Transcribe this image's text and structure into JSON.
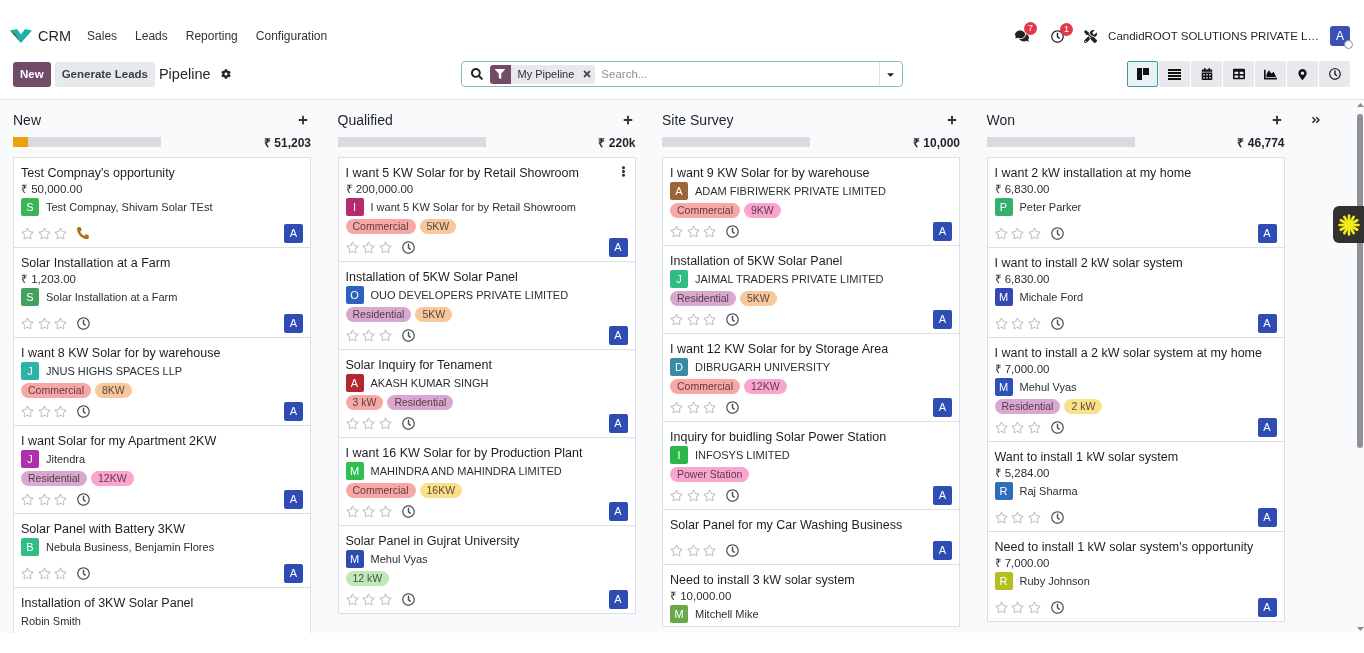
{
  "navbar": {
    "app": "CRM",
    "menu": [
      "Sales",
      "Leads",
      "Reporting",
      "Configuration"
    ],
    "messages_count": "7",
    "activities_count": "1",
    "company": "CandidROOT SOLUTIONS PRIVATE L…",
    "user_initial": "A"
  },
  "control_panel": {
    "buttons": [
      {
        "label": "New",
        "kind": "primary"
      },
      {
        "label": "Generate Leads",
        "kind": "secondary"
      }
    ],
    "title": "Pipeline",
    "search": {
      "facet": "My Pipeline",
      "placeholder": "Search..."
    },
    "views": [
      {
        "kind": "kanban",
        "selected": true
      },
      {
        "kind": "list",
        "selected": false
      },
      {
        "kind": "calendar",
        "selected": false
      },
      {
        "kind": "pivot",
        "selected": false
      },
      {
        "kind": "graph",
        "selected": false
      },
      {
        "kind": "map",
        "selected": false
      },
      {
        "kind": "activity",
        "selected": false
      }
    ]
  },
  "columns": [
    {
      "title": "New",
      "total": "₹ 51,203",
      "level": 0.1,
      "cards": [
        {
          "title": "Test Compnay's opportunity",
          "amount": "₹ 50,000.00",
          "partner": {
            "initial": "S",
            "name": "Test Compnay, Shivam Solar TEst",
            "color": "#3cb55a"
          },
          "stars": 0,
          "call_planned": true,
          "assignee": "A",
          "show_menu": false
        },
        {
          "title": "Solar Installation at a Farm",
          "amount": "₹ 1,203.00",
          "partner": {
            "initial": "S",
            "name": "Solar Installation at a Farm",
            "color": "#46a160"
          },
          "stars": 0,
          "call_planned": false,
          "assignee": "A",
          "show_menu": false
        },
        {
          "title": "I want 8 KW Solar for by warehouse",
          "partner": {
            "initial": "J",
            "name": "JNUS HIGHS SPACES LLP",
            "color": "#2bb5a8"
          },
          "tags": [
            {
              "label": "Commercial",
              "color": "#f7a8a6"
            },
            {
              "label": "8KW",
              "color": "#f6c89c"
            }
          ],
          "stars": 0,
          "call_planned": false,
          "assignee": "A",
          "show_menu": false
        },
        {
          "title": "I want Solar for my Apartment 2KW",
          "partner": {
            "initial": "J",
            "name": "Jitendra",
            "color": "#b12fab"
          },
          "tags": [
            {
              "label": "Residential",
              "color": "#d9a8d0"
            },
            {
              "label": "12KW",
              "color": "#f9a5cf"
            }
          ],
          "stars": 0,
          "call_planned": false,
          "assignee": "A",
          "show_menu": false
        },
        {
          "title": "Solar Panel with Battery 3KW",
          "partner": {
            "initial": "B",
            "name": "Nebula Business, Benjamin Flores",
            "color": "#2fbf85"
          },
          "stars": 0,
          "call_planned": false,
          "assignee": "A",
          "show_menu": false
        },
        {
          "title": "Installation of 3KW Solar Panel",
          "partner": {
            "name": "Robin Smith"
          },
          "show_menu": false
        }
      ]
    },
    {
      "title": "Qualified",
      "total": "₹ 220k",
      "cards": [
        {
          "title": "I want 5 KW Solar for by Retail Showroom",
          "amount": "₹ 200,000.00",
          "partner": {
            "initial": "I",
            "name": "I want 5 KW Solar for by Retail Showroom",
            "color": "#b62a6f"
          },
          "tags": [
            {
              "label": "Commercial",
              "color": "#f7a8a6"
            },
            {
              "label": "5KW",
              "color": "#f6c89c"
            }
          ],
          "stars": 0,
          "call_planned": false,
          "assignee": "A",
          "show_menu": true
        },
        {
          "title": "Installation of 5KW Solar Panel",
          "partner": {
            "initial": "O",
            "name": "OUO DEVELOPERS PRIVATE LIMITED",
            "color": "#2d62c0"
          },
          "tags": [
            {
              "label": "Residential",
              "color": "#d9a8d0"
            },
            {
              "label": "5KW",
              "color": "#f6c89c"
            }
          ],
          "stars": 0,
          "call_planned": false,
          "assignee": "A",
          "show_menu": false
        },
        {
          "title": "Solar Inquiry for Tenament",
          "partner": {
            "initial": "A",
            "name": "AKASH KUMAR SINGH",
            "color": "#b3282f"
          },
          "tags": [
            {
              "label": "3 kW",
              "color": "#f7a8a6"
            },
            {
              "label": "Residential",
              "color": "#d9a8d0"
            }
          ],
          "stars": 0,
          "call_planned": false,
          "assignee": "A",
          "show_menu": false
        },
        {
          "title": "I want 16 KW Solar for by Production Plant",
          "partner": {
            "initial": "M",
            "name": "MAHINDRA AND MAHINDRA LIMITED",
            "color": "#2ec04f"
          },
          "tags": [
            {
              "label": "Commercial",
              "color": "#f7a8a6"
            },
            {
              "label": "16KW",
              "color": "#fbe08a"
            }
          ],
          "stars": 0,
          "call_planned": false,
          "assignee": "A",
          "show_menu": false
        },
        {
          "title": "Solar Panel in Gujrat University",
          "partner": {
            "initial": "M",
            "name": "Mehul Vyas",
            "color": "#2b4cb3"
          },
          "tags": [
            {
              "label": "12 kW",
              "color": "#bdeab8"
            }
          ],
          "stars": 0,
          "call_planned": false,
          "assignee": "A",
          "show_menu": false
        }
      ]
    },
    {
      "title": "Site Survey",
      "total": "₹ 10,000",
      "cards": [
        {
          "title": "I want 9 KW Solar for by warehouse",
          "partner": {
            "initial": "A",
            "name": "ADAM FIBRIWERK PRIVATE LIMITED",
            "color": "#9c6538"
          },
          "tags": [
            {
              "label": "Commercial",
              "color": "#f7a8a6"
            },
            {
              "label": "9KW",
              "color": "#f9a5cf"
            }
          ],
          "stars": 0,
          "call_planned": false,
          "assignee": "A",
          "show_menu": false
        },
        {
          "title": "Installation of 5KW Solar Panel",
          "partner": {
            "initial": "J",
            "name": "JAIMAL TRADERS PRIVATE LIMITED",
            "color": "#2ebd84"
          },
          "tags": [
            {
              "label": "Residential",
              "color": "#d9a8d0"
            },
            {
              "label": "5KW",
              "color": "#f6c89c"
            }
          ],
          "stars": 0,
          "call_planned": false,
          "assignee": "A",
          "show_menu": false
        },
        {
          "title": "I want 12 KW Solar for by Storage Area",
          "partner": {
            "initial": "D",
            "name": "DIBRUGARH UNIVERSITY",
            "color": "#3b8aa4"
          },
          "tags": [
            {
              "label": "Commercial",
              "color": "#f7a8a6"
            },
            {
              "label": "12KW",
              "color": "#f9a5cf"
            }
          ],
          "stars": 0,
          "call_planned": false,
          "assignee": "A",
          "show_menu": false
        },
        {
          "title": "Inquiry for buidling Solar Power Station",
          "partner": {
            "initial": "I",
            "name": "INFOSYS LIMITED",
            "color": "#2cb54a"
          },
          "tags": [
            {
              "label": "Power Station",
              "color": "#f9a5cf"
            }
          ],
          "stars": 0,
          "call_planned": false,
          "assignee": "A",
          "show_menu": false
        },
        {
          "title": "Solar Panel for my Car Washing Business",
          "stars": 0,
          "call_planned": false,
          "assignee": "A",
          "show_menu": false
        },
        {
          "title": "Need to install 3 kW solar system",
          "amount": "₹ 10,000.00",
          "partner": {
            "initial": "M",
            "name": "Mitchell Mike",
            "color": "#6aa84a"
          },
          "show_menu": false
        }
      ]
    },
    {
      "title": "Won",
      "total": "₹ 46,774",
      "cards": [
        {
          "title": "I want 2 kW installation at my home",
          "amount": "₹ 6,830.00",
          "partner": {
            "initial": "P",
            "name": "Peter Parker",
            "color": "#36ae6e"
          },
          "stars": 0,
          "call_planned": false,
          "assignee": "A",
          "show_menu": false
        },
        {
          "title": "I want to install 2 kW solar system",
          "amount": "₹ 6,830.00",
          "partner": {
            "initial": "M",
            "name": "Michale Ford",
            "color": "#3448b5"
          },
          "stars": 0,
          "call_planned": false,
          "assignee": "A",
          "show_menu": false
        },
        {
          "title": "I want to install a 2 kW solar system at my home",
          "amount": "₹ 7,000.00",
          "partner": {
            "initial": "M",
            "name": "Mehul Vyas",
            "color": "#2c52b8"
          },
          "tags": [
            {
              "label": "Residential",
              "color": "#d9a8d0"
            },
            {
              "label": "2 kW",
              "color": "#fbe08a"
            }
          ],
          "stars": 0,
          "call_planned": false,
          "assignee": "A",
          "show_menu": false
        },
        {
          "title": "Want to install 1 kW solar system",
          "amount": "₹ 5,284.00",
          "partner": {
            "initial": "R",
            "name": "Raj Sharma",
            "color": "#2e6dbc"
          },
          "stars": 0,
          "call_planned": false,
          "assignee": "A",
          "show_menu": false
        },
        {
          "title": "Need to install 1 kW solar system's opportunity",
          "amount": "₹ 7,000.00",
          "partner": {
            "initial": "R",
            "name": "Ruby Johnson",
            "color": "#b4c01d"
          },
          "stars": 0,
          "call_planned": false,
          "assignee": "A",
          "show_menu": false
        }
      ]
    }
  ]
}
